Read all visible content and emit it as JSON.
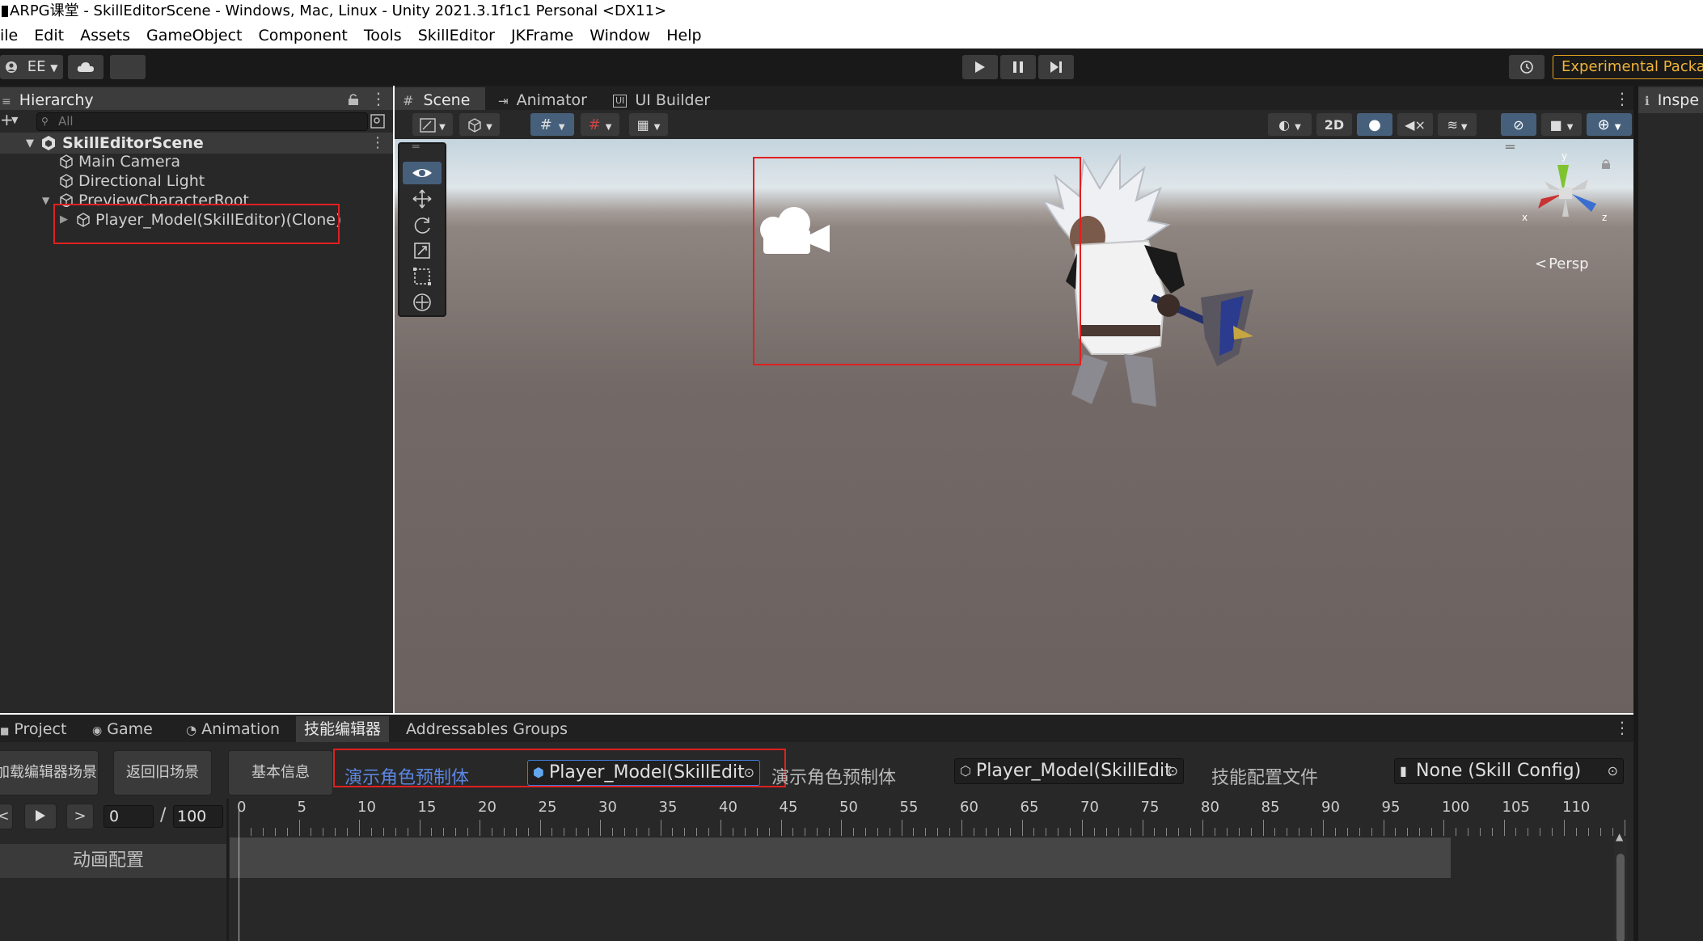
{
  "title_bar": {
    "text": "ARPG课堂 - SkillEditorScene - Windows, Mac, Linux - Unity 2021.3.1f1c1 Personal <DX11>"
  },
  "menu": [
    "ile",
    "Edit",
    "Assets",
    "GameObject",
    "Component",
    "Tools",
    "SkillEditor",
    "JKFrame",
    "Window",
    "Help"
  ],
  "toolbar": {
    "account": "EE",
    "experimental": "Experimental Packag"
  },
  "hierarchy": {
    "tab": "Hierarchy",
    "search_placeholder": "All",
    "items": [
      {
        "label": "SkillEditorScene"
      },
      {
        "label": "Main Camera"
      },
      {
        "label": "Directional Light"
      },
      {
        "label": "PreviewCharacterRoot"
      },
      {
        "label": "Player_Model(SkillEditor)(Clone)"
      }
    ]
  },
  "scene": {
    "tabs": [
      "Scene",
      "Animator",
      "UI Builder"
    ],
    "mode_2d": "2D",
    "persp_label": "Persp",
    "gizmo_axes": {
      "x": "x",
      "y": "y",
      "z": "z"
    }
  },
  "inspector": {
    "tab": "Inspe"
  },
  "bottom_tabs": [
    "Project",
    "Game",
    "Animation",
    "技能编辑器",
    "Addressables Groups"
  ],
  "skill_editor": {
    "buttons": {
      "load_scene": "加载编辑器场景",
      "back_scene": "返回旧场景",
      "basic_info": "基本信息"
    },
    "preview_label_1": "演示角色预制体",
    "preview_field_1": "Player_Model(SkillEdit",
    "preview_label_2": "演示角色预制体",
    "preview_field_2": "Player_Model(SkillEdit",
    "config_label": "技能配置文件",
    "config_field": "None (Skill Config)",
    "playback": {
      "prev": "<",
      "next": ">",
      "current_frame": "0",
      "separator": "/",
      "max_frame": "100"
    },
    "track_label": "动画配置",
    "ruler": [
      "0",
      "5",
      "10",
      "15",
      "20",
      "25",
      "30",
      "35",
      "40",
      "45",
      "50",
      "55",
      "60",
      "65",
      "70",
      "75",
      "80",
      "85",
      "90",
      "95",
      "100",
      "105",
      "110"
    ]
  }
}
